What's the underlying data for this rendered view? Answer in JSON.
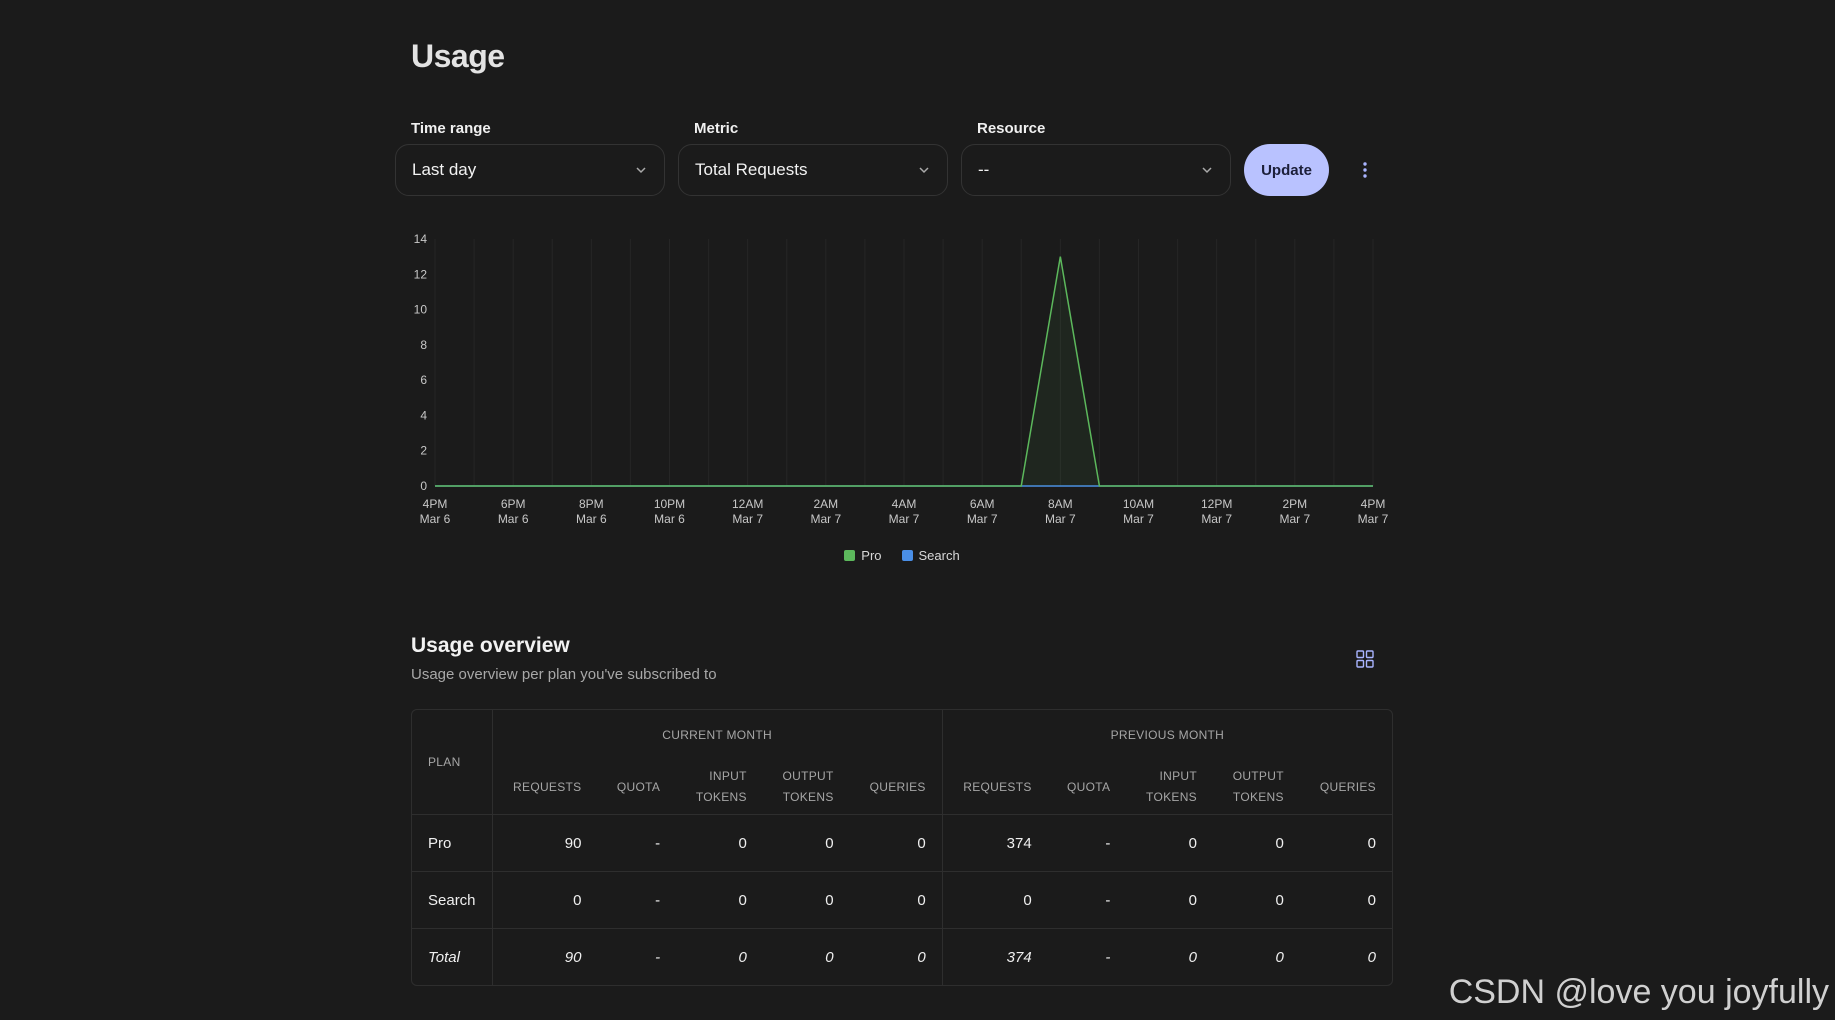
{
  "page": {
    "title": "Usage"
  },
  "filters": {
    "time_range": {
      "label": "Time range",
      "value": "Last day"
    },
    "metric": {
      "label": "Metric",
      "value": "Total Requests"
    },
    "resource": {
      "label": "Resource",
      "value": "--"
    },
    "update_label": "Update"
  },
  "chart_data": {
    "type": "area",
    "x_ticks": [
      [
        "4PM",
        "Mar 6"
      ],
      [
        "6PM",
        "Mar 6"
      ],
      [
        "8PM",
        "Mar 6"
      ],
      [
        "10PM",
        "Mar 6"
      ],
      [
        "12AM",
        "Mar 7"
      ],
      [
        "2AM",
        "Mar 7"
      ],
      [
        "4AM",
        "Mar 7"
      ],
      [
        "6AM",
        "Mar 7"
      ],
      [
        "8AM",
        "Mar 7"
      ],
      [
        "10AM",
        "Mar 7"
      ],
      [
        "12PM",
        "Mar 7"
      ],
      [
        "2PM",
        "Mar 7"
      ],
      [
        "4PM",
        "Mar 7"
      ]
    ],
    "y_ticks": [
      0,
      2,
      4,
      6,
      8,
      10,
      12,
      14
    ],
    "ylim": [
      0,
      14
    ],
    "x_hours": [
      "4PM Mar 6",
      "5PM Mar 6",
      "6PM Mar 6",
      "7PM Mar 6",
      "8PM Mar 6",
      "9PM Mar 6",
      "10PM Mar 6",
      "11PM Mar 6",
      "12AM Mar 7",
      "1AM Mar 7",
      "2AM Mar 7",
      "3AM Mar 7",
      "4AM Mar 7",
      "5AM Mar 7",
      "6AM Mar 7",
      "7AM Mar 7",
      "8AM Mar 7",
      "9AM Mar 7",
      "10AM Mar 7",
      "11AM Mar 7",
      "12PM Mar 7",
      "1PM Mar 7",
      "2PM Mar 7",
      "3PM Mar 7",
      "4PM Mar 7"
    ],
    "series": [
      {
        "name": "Pro",
        "color": "#5cb85c",
        "values": [
          0,
          0,
          0,
          0,
          0,
          0,
          0,
          0,
          0,
          0,
          0,
          0,
          0,
          0,
          0,
          0,
          13,
          0,
          0,
          0,
          0,
          0,
          0,
          0,
          0
        ]
      },
      {
        "name": "Search",
        "color": "#4a8fe7",
        "values": [
          0,
          0,
          0,
          0,
          0,
          0,
          0,
          0,
          0,
          0,
          0,
          0,
          0,
          0,
          0,
          0,
          0,
          0,
          0,
          0,
          0,
          0,
          0,
          0,
          0
        ]
      }
    ],
    "grid": true,
    "legend_position": "bottom-center"
  },
  "overview": {
    "title": "Usage overview",
    "subtitle": "Usage overview per plan you've subscribed to",
    "table": {
      "plan_header": "PLAN",
      "groups": [
        "CURRENT MONTH",
        "PREVIOUS MONTH"
      ],
      "columns": [
        [
          "REQUESTS"
        ],
        [
          "QUOTA"
        ],
        [
          "INPUT",
          "TOKENS"
        ],
        [
          "OUTPUT",
          "TOKENS"
        ],
        [
          "QUERIES"
        ]
      ],
      "rows": [
        {
          "plan": "Pro",
          "current": [
            "90",
            "-",
            "0",
            "0",
            "0"
          ],
          "previous": [
            "374",
            "-",
            "0",
            "0",
            "0"
          ]
        },
        {
          "plan": "Search",
          "current": [
            "0",
            "-",
            "0",
            "0",
            "0"
          ],
          "previous": [
            "0",
            "-",
            "0",
            "0",
            "0"
          ]
        },
        {
          "plan": "Total",
          "current": [
            "90",
            "-",
            "0",
            "0",
            "0"
          ],
          "previous": [
            "374",
            "-",
            "0",
            "0",
            "0"
          ],
          "is_total": true
        }
      ]
    }
  },
  "watermark": "CSDN @love you joyfully",
  "colors": {
    "accent": "#b9c2ff",
    "background": "#1b1b1b"
  }
}
